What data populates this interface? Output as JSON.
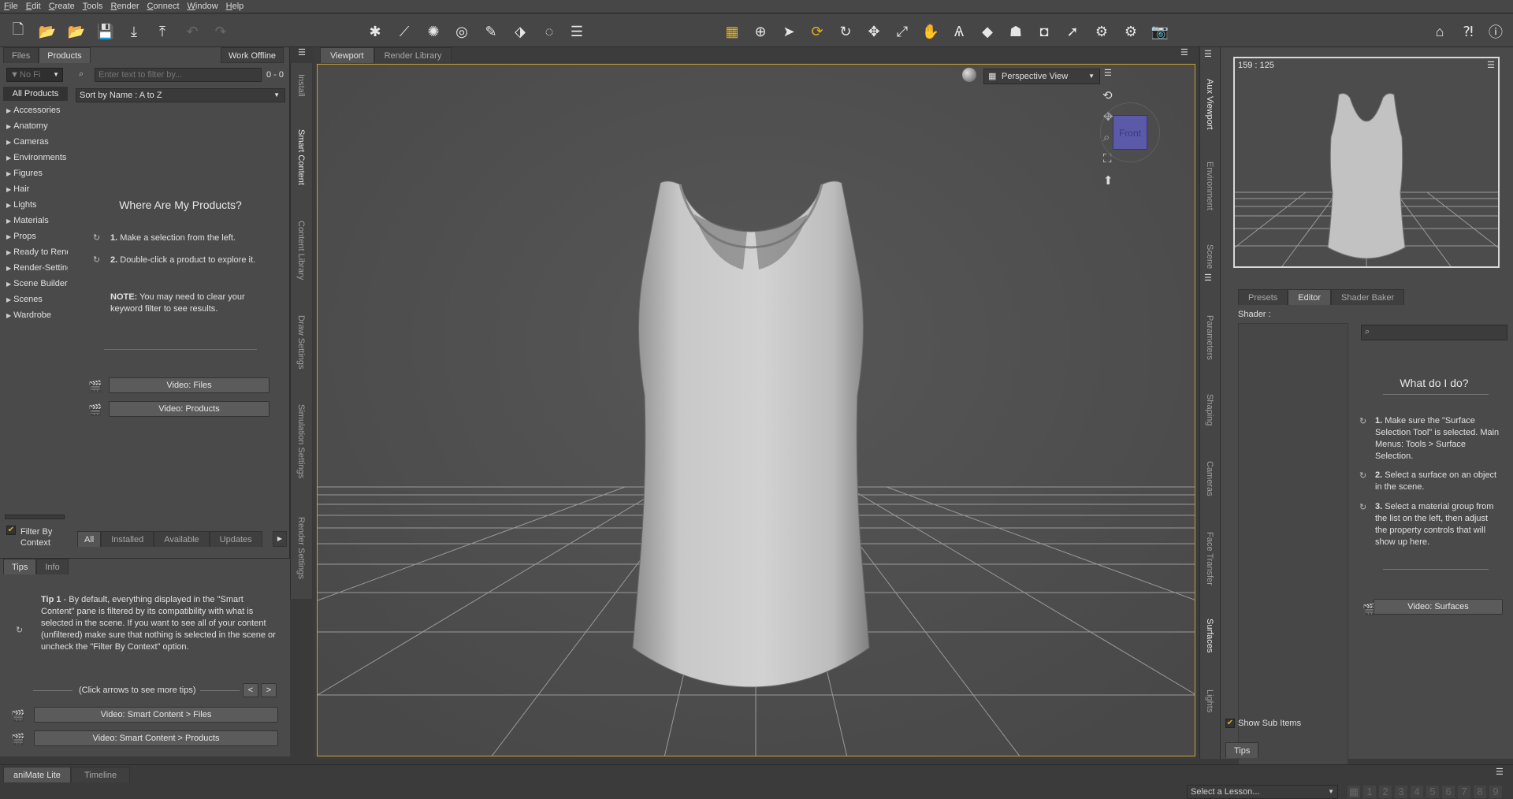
{
  "menu": [
    "File",
    "Edit",
    "Create",
    "Tools",
    "Render",
    "Connect",
    "Window",
    "Help"
  ],
  "left_panel": {
    "tabs": [
      "Files",
      "Products"
    ],
    "active_tab": "Products",
    "work_offline_label": "Work Offline",
    "filter_dropdown": "No Fi",
    "search_placeholder": "Enter text to filter by...",
    "result_count": "0 - 0",
    "all_products_label": "All Products",
    "sort_label": "Sort by Name : A to Z",
    "categories": [
      "Accessories",
      "Anatomy",
      "Cameras",
      "Environments",
      "Figures",
      "Hair",
      "Lights",
      "Materials",
      "Props",
      "Ready to Render",
      "Render-Settings",
      "Scene Builder",
      "Scenes",
      "Wardrobe"
    ],
    "help_title": "Where Are My Products?",
    "step1_num": "1.",
    "step1": "Make a selection from the left.",
    "step2_num": "2.",
    "step2": "Double-click a product to explore it.",
    "note_label": "NOTE:",
    "note_text": "You may need to clear your keyword filter to see results.",
    "video_files": "Video: Files",
    "video_products": "Video: Products",
    "filter_by_context": "Filter By Context",
    "filter_tabs": [
      "All",
      "Installed",
      "Available",
      "Updates"
    ],
    "side_tabs": [
      "Install",
      "Smart Content",
      "Content Library",
      "Draw Settings",
      "Simulation Settings",
      "Render Settings"
    ]
  },
  "tips_panel": {
    "tabs": [
      "Tips",
      "Info"
    ],
    "tip_label": "Tip 1",
    "tip_text": " - By default, everything displayed in the \"Smart Content\" pane is filtered by its compatibility with what is selected in the scene. If you want to see all of your content (unfiltered) make sure that nothing is selected in the scene or uncheck the \"Filter By Context\" option.",
    "click_arrows": "(Click arrows to see more tips)",
    "prev": "<",
    "next": ">",
    "video1": "Video: Smart Content > Files",
    "video2": "Video: Smart Content > Products"
  },
  "viewport": {
    "tabs": [
      "Viewport",
      "Render Library"
    ],
    "active_tab": "Viewport",
    "view_select": "Perspective View",
    "cube_label": "Front"
  },
  "aux_viewport": {
    "coords": "159 : 125",
    "side_tabs": [
      "Aux Viewport",
      "Environment",
      "Scene"
    ]
  },
  "surfaces": {
    "tabs": [
      "Presets",
      "Editor",
      "Shader Baker"
    ],
    "active_tab": "Editor",
    "shader_label": "Shader :",
    "help_title": "What do I do?",
    "step1_num": "1.",
    "step1": "Make sure the \"Surface Selection Tool\" is selected. Main Menus: Tools > Surface Selection.",
    "step2_num": "2.",
    "step2": "Select a surface on an object in the scene.",
    "step3_num": "3.",
    "step3": "Select a material group from the list on the left, then adjust the property controls that will show up here.",
    "video": "Video: Surfaces",
    "show_sub_items": "Show Sub Items",
    "tips_tab": "Tips",
    "side_tabs": [
      "Parameters",
      "Shaping",
      "Cameras",
      "Face Transfer",
      "Surfaces",
      "Lights"
    ]
  },
  "bottom": {
    "tabs": [
      "aniMate Lite",
      "Timeline"
    ],
    "lesson_select": "Select a Lesson...",
    "page_numbers": [
      "1",
      "2",
      "3",
      "4",
      "5",
      "6",
      "7",
      "8",
      "9"
    ]
  },
  "colors": {
    "viewport_border": "#c8a234",
    "accent_gold": "#e0b020",
    "cube_blue": "#5a5aa8"
  }
}
